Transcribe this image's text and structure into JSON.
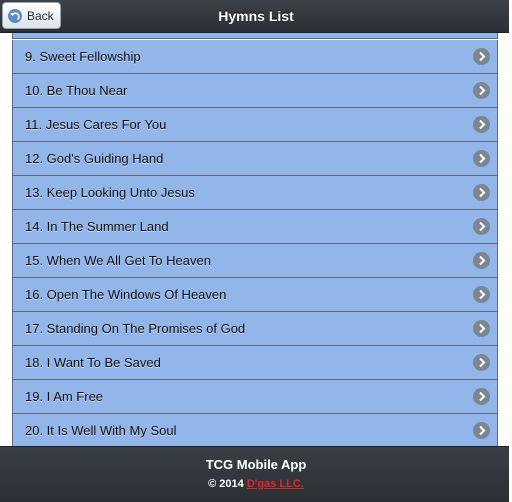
{
  "header": {
    "title": "Hymns List",
    "back_label": "Back"
  },
  "hymns": [
    "9. Sweet Fellowship",
    "10. Be Thou Near",
    "11. Jesus Cares For You",
    "12. God's Guiding Hand",
    "13. Keep Looking Unto Jesus",
    "14. In The Summer Land",
    "15. When We All Get To Heaven",
    "16. Open The Windows Of Heaven",
    "17. Standing On The Promises of God",
    "18. I Want To Be Saved",
    "19. I Am Free",
    "20. It Is Well With My Soul"
  ],
  "footer": {
    "app_name": "TCG Mobile App",
    "copyright_prefix": "© 2014 ",
    "company_link": "D'gas LLC."
  },
  "colors": {
    "list_item_bg": "#92b6ea",
    "header_bg": "#2b2f34",
    "link": "#e0272c"
  },
  "icons": {
    "back": "back-arrow-icon",
    "item": "chevron-right-icon"
  }
}
